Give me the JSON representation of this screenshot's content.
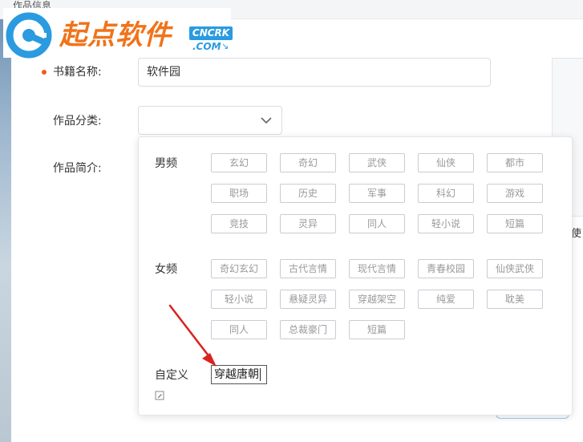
{
  "window": {
    "title": "作品信息"
  },
  "logo": {
    "text": "起点软件",
    "badge": "CNCRK",
    "domain": ".COM"
  },
  "form": {
    "book_name_label": "书籍名称:",
    "book_name_value": "软件园",
    "category_label": "作品分类:",
    "category_value": "",
    "intro_label": "作品简介:"
  },
  "dropdown": {
    "male": {
      "label": "男频",
      "tags": [
        "玄幻",
        "奇幻",
        "武侠",
        "仙侠",
        "都市",
        "职场",
        "历史",
        "军事",
        "科幻",
        "游戏",
        "竞技",
        "灵异",
        "同人",
        "轻小说",
        "短篇"
      ]
    },
    "female": {
      "label": "女频",
      "tags": [
        "奇幻玄幻",
        "古代言情",
        "现代言情",
        "青春校园",
        "仙侠武侠",
        "轻小说",
        "悬疑灵异",
        "穿越架空",
        "纯爱",
        "耽美",
        "同人",
        "总裁豪门",
        "短篇"
      ]
    },
    "custom": {
      "label": "自定义",
      "value": "穿越唐朝"
    }
  },
  "right_panel": {
    "partial_text": "使"
  },
  "colors": {
    "accent_orange": "#f05a22",
    "arrow_red": "#d9231f",
    "logo_orange": "#f0731a",
    "logo_blue": "#2a9be0"
  },
  "icons": {
    "select_chevron": "chevron-down-icon",
    "edit": "edit-icon",
    "logo_mark": "logo-mark-icon",
    "annotation": "arrow-annotation"
  }
}
